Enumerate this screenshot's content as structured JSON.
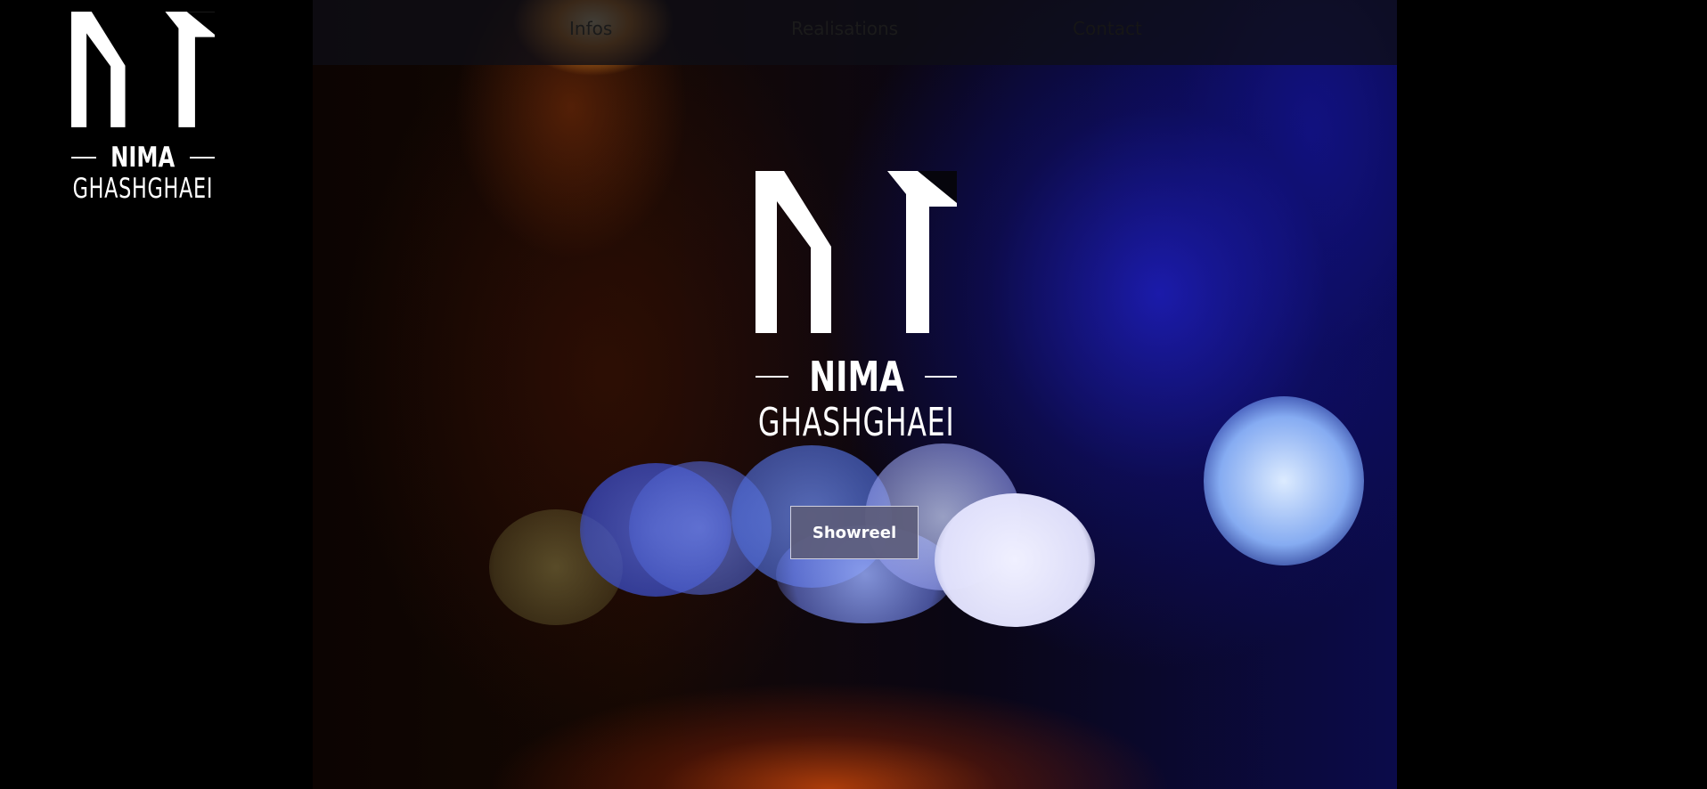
{
  "brand": {
    "first_name": "NIMA",
    "last_name": "GHASHGHAEI",
    "logo_icon": "nima-monogram-icon"
  },
  "nav": {
    "items": [
      {
        "label": "Infos"
      },
      {
        "label": "Realisations"
      },
      {
        "label": "Contact"
      }
    ]
  },
  "hero": {
    "first_name": "NIMA",
    "last_name": "GHASHGHAEI",
    "button_label": "Showreel"
  },
  "colors": {
    "page_background": "#000000",
    "nav_bar": "#0e0e16",
    "button_background": "#5c5c7a",
    "button_border": "#d0d0de",
    "text": "#ffffff"
  }
}
